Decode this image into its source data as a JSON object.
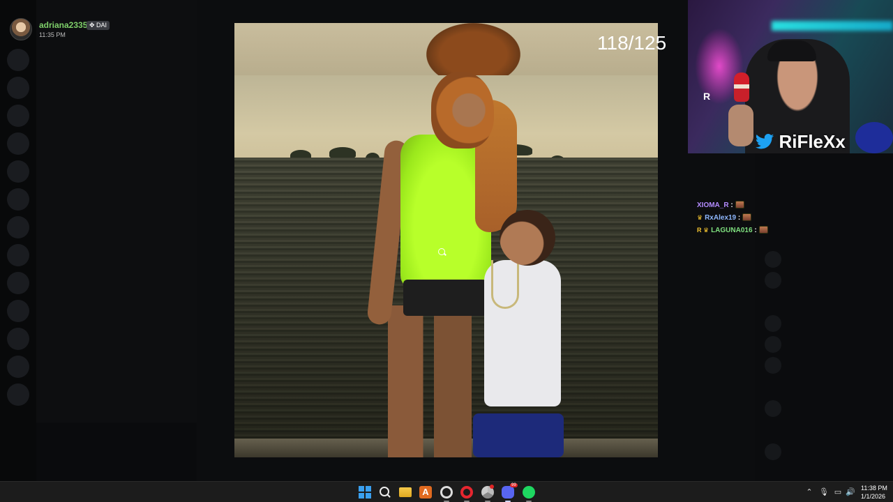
{
  "viewer": {
    "username": "adriana2335",
    "badge": "✥ DAI",
    "time": "11:35 PM"
  },
  "image_viewer": {
    "counter": "118/125"
  },
  "webcam": {
    "brand": "RiFleXx",
    "brand_icon": "twitter-icon"
  },
  "chat": {
    "messages": [
      {
        "user": "XIOMA_R",
        "sep": " :",
        "color": "#b48cff",
        "badge": ""
      },
      {
        "user": "RxAlex19",
        "sep": " :",
        "color": "#8fb8ff",
        "badge": "♛"
      },
      {
        "user": "LAGUNA016",
        "sep": " :",
        "color": "#7fe07f",
        "badge": "R ♛"
      }
    ]
  },
  "taskbar": {
    "apps": [
      "start-icon",
      "search-icon",
      "folder-icon",
      "app-a-icon",
      "obs-icon",
      "opera-icon",
      "chrome-icon",
      "discord-icon",
      "spotify-icon"
    ],
    "app_a_letter": "A",
    "discord_badge": "99",
    "clock_time": "11:38 PM",
    "clock_date": "1/1/2026",
    "tray_icons": [
      "chevron-up-icon",
      "microphone-icon",
      "network-icon",
      "volume-icon"
    ]
  },
  "colors": {
    "viewer_name": "#7fd06a",
    "twitter_blue": "#1da1f2",
    "accent_green_top": "#b8ff2a"
  }
}
